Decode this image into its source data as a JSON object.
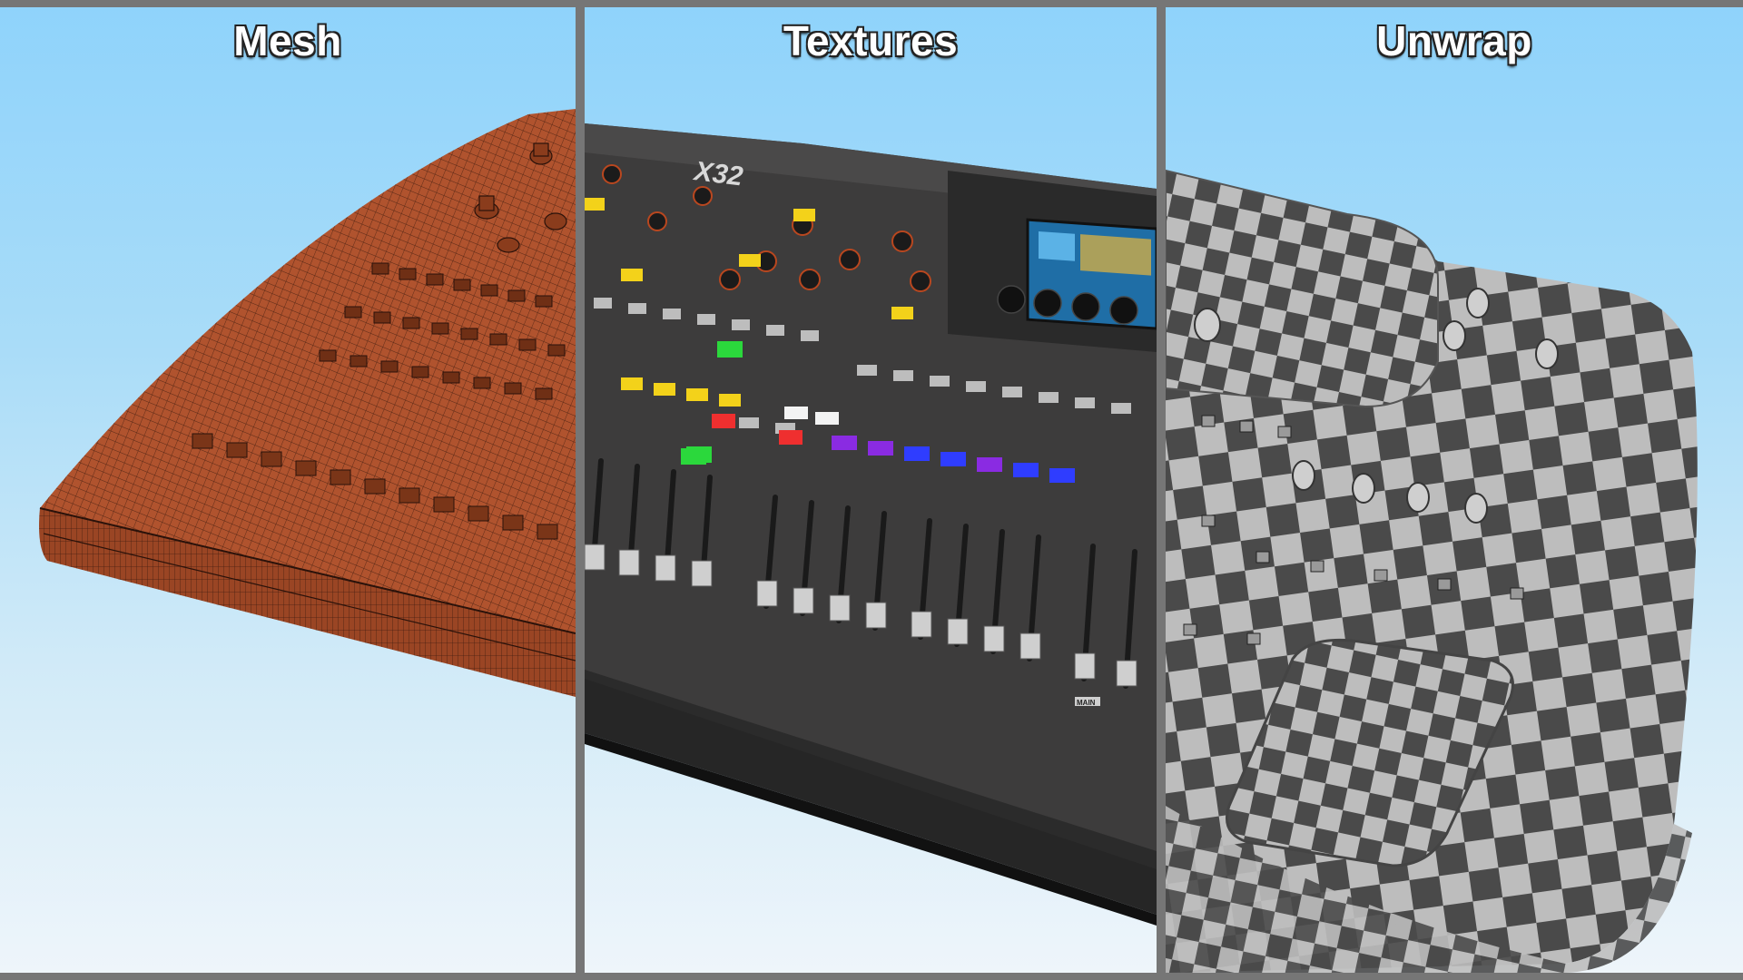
{
  "panels": [
    {
      "title": "Mesh"
    },
    {
      "title": "Textures"
    },
    {
      "title": "Unwrap"
    }
  ],
  "mixer": {
    "brand_label": "X32",
    "main_label": "MAIN"
  },
  "colors": {
    "background_top": "#8fd3fb",
    "background_bottom": "#eef5fa",
    "divider": "#767676",
    "mesh_fill": "#b0532e",
    "mesh_wire": "#3a1a0e",
    "console_body": "#3d3c3c",
    "checker_dark": "#4a4a4a",
    "checker_light": "#bdbdbd"
  }
}
